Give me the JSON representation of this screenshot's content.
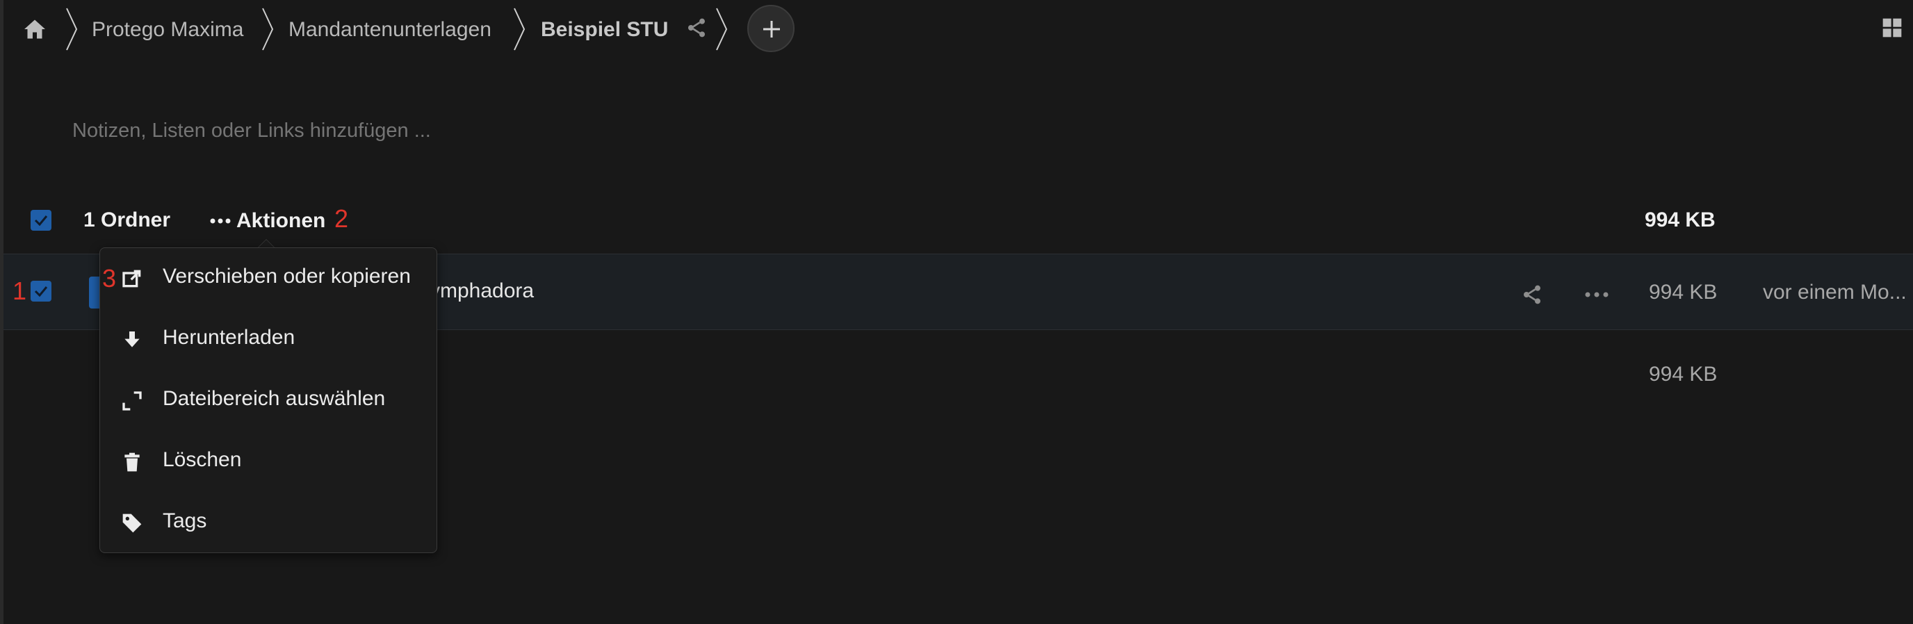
{
  "breadcrumb": {
    "home_icon": "home-icon",
    "items": [
      "Protego Maxima",
      "Mandantenunterlagen",
      "Beispiel STU"
    ],
    "share_icon": "share-icon",
    "add_icon": "plus-icon"
  },
  "notes": {
    "placeholder": "Notizen, Listen oder Links hinzufügen ..."
  },
  "list_header": {
    "count_label": "1 Ordner",
    "actions_label": "Aktionen",
    "total_size": "994 KB",
    "selected": true
  },
  "file_row": {
    "name_visible": "ymphadora",
    "size": "994 KB",
    "modified": "vor einem Mo...",
    "selected": true
  },
  "summary": {
    "size": "994 KB"
  },
  "actions_menu": {
    "items": [
      {
        "label": "Verschieben oder kopieren",
        "icon": "move-copy-icon"
      },
      {
        "label": "Herunterladen",
        "icon": "download-icon"
      },
      {
        "label": "Dateibereich auswählen",
        "icon": "select-range-icon"
      },
      {
        "label": "Löschen",
        "icon": "trash-icon"
      },
      {
        "label": "Tags",
        "icon": "tag-icon"
      }
    ]
  },
  "annotations": [
    "1",
    "2",
    "3"
  ],
  "colors": {
    "accent": "#1f5ea8",
    "annotation": "#e0352b",
    "background": "#181818"
  }
}
